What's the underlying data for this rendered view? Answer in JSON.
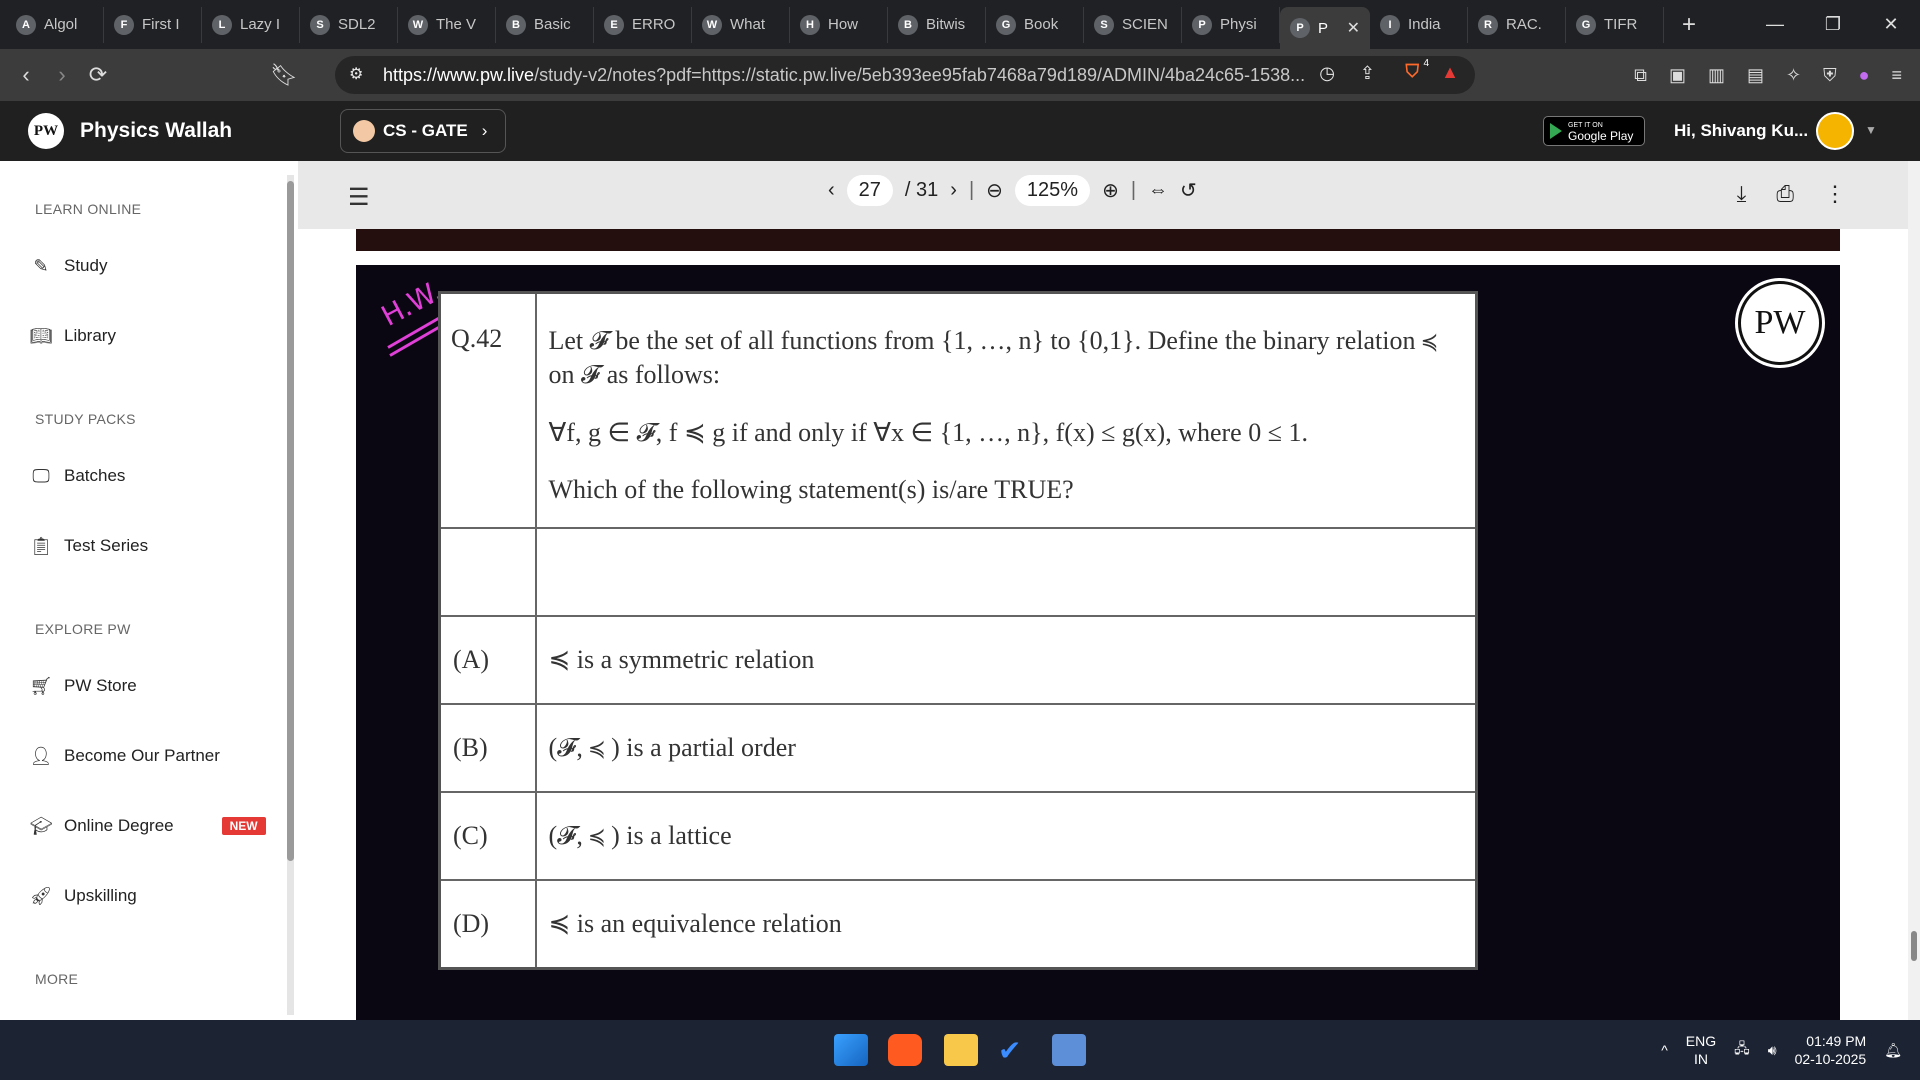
{
  "browser": {
    "tabs": [
      {
        "label": "Algol",
        "icon": "A"
      },
      {
        "label": "First I",
        "icon": "F"
      },
      {
        "label": "Lazy I",
        "icon": "L"
      },
      {
        "label": "SDL2",
        "icon": "S"
      },
      {
        "label": "The V",
        "icon": "W"
      },
      {
        "label": "Basic",
        "icon": "B"
      },
      {
        "label": "ERRO",
        "icon": "E"
      },
      {
        "label": "What",
        "icon": "W"
      },
      {
        "label": "How",
        "icon": "H"
      },
      {
        "label": "Bitwis",
        "icon": "B"
      },
      {
        "label": "Book",
        "icon": "G"
      },
      {
        "label": "SCIEN",
        "icon": "S"
      },
      {
        "label": "Physi",
        "icon": "P"
      },
      {
        "label": "P",
        "icon": "P",
        "active": true
      },
      {
        "label": "India",
        "icon": "I"
      },
      {
        "label": "RAC.",
        "icon": "R"
      },
      {
        "label": "TIFR",
        "icon": "G"
      }
    ],
    "new_tab": "+",
    "url_host": "https://www.pw.live",
    "url_rest": "/study-v2/notes?pdf=https://static.pw.live/5eb393ee95fab7468a79d189/ADMIN/4ba24c65-1538...",
    "brave_count": "4"
  },
  "site": {
    "brand": "Physics Wallah",
    "logo_text": "PW",
    "course": "CS - GATE",
    "gplay_small": "GET IT ON",
    "gplay": "Google Play",
    "greeting": "Hi, Shivang Ku..."
  },
  "sidebar": {
    "sections": [
      "LEARN ONLINE",
      "STUDY PACKS",
      "EXPLORE PW",
      "MORE"
    ],
    "items": [
      {
        "label": "Study",
        "icon": "edit-icon"
      },
      {
        "label": "Library",
        "icon": "book-icon"
      },
      {
        "label": "Batches",
        "icon": "monitor-icon"
      },
      {
        "label": "Test Series",
        "icon": "clipboard-icon"
      },
      {
        "label": "PW Store",
        "icon": "cart-icon"
      },
      {
        "label": "Become Our Partner",
        "icon": "partner-icon"
      },
      {
        "label": "Online Degree",
        "icon": "degree-icon",
        "badge": "NEW"
      },
      {
        "label": "Upskilling",
        "icon": "rocket-icon"
      }
    ]
  },
  "pdf": {
    "page": "27",
    "total": "/ 31",
    "zoom": "125%"
  },
  "question": {
    "hw": "H.W.",
    "number": "Q.42",
    "line1": "Let 𝓕  be the set of all functions from {1, …, n} to {0,1}. Define the binary relation ≼ on 𝓕 as follows:",
    "line2": "∀f, g ∈ 𝓕,  f ≼ g if and only if ∀x ∈ {1, …, n},  f(x) ≤ g(x),  where 0 ≤ 1.",
    "line3": "Which of the following statement(s) is/are TRUE?",
    "options": [
      {
        "key": "(A)",
        "text": "≼ is a symmetric relation"
      },
      {
        "key": "(B)",
        "text": "(𝓕, ≼ ) is a partial order"
      },
      {
        "key": "(C)",
        "text": "(𝓕, ≼ ) is a lattice"
      },
      {
        "key": "(D)",
        "text": "≼ is an equivalence relation"
      }
    ]
  },
  "taskbar": {
    "lang1": "ENG",
    "lang2": "IN",
    "time": "01:49 PM",
    "date": "02-10-2025"
  }
}
